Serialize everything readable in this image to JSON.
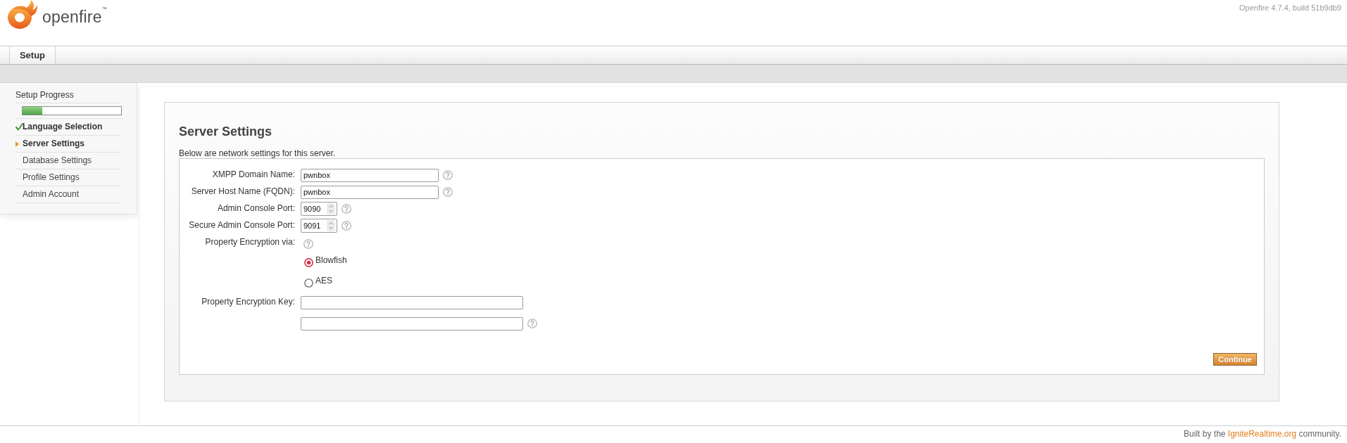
{
  "header": {
    "logo": "openfire$^{™}$",
    "version": "Openfire 4.7.4, build 51b9db9"
  },
  "tabs": [
    {
      "label": "Setup",
      "selected": true
    }
  ],
  "sidebar": {
    "title": "Setup Progress",
    "progress": {
      "level": 0.2
    },
    "steps": [
      {
        "label": "Language Selection",
        "completed": true,
        "selected": false
      },
      {
        "label": "Server Settings",
        "completed": false,
        "selected": true
      },
      {
        "label": "Database Settings",
        "completed": false,
        "selected": false
      },
      {
        "label": "Profile Settings",
        "completed": false,
        "selected": false
      },
      {
        "label": "Admin Account",
        "completed": false,
        "selected": false
      }
    ]
  },
  "form": {
    "title": "Server Settings",
    "intro": "Below are network settings for this server.",
    "fields": [
      {
        "kind": "text",
        "label": "XMPP Domain Name:",
        "value": "pwnbox",
        "help": true
      },
      {
        "kind": "text",
        "label": "Server Host Name (FQDN):",
        "value": "pwnbox",
        "help": true
      },
      {
        "kind": "number",
        "label": "Admin Console Port:",
        "value": "9090",
        "help": true
      },
      {
        "kind": "number",
        "label": "Secure Admin Console Port:",
        "value": "9091",
        "help": true
      },
      {
        "kind": "radio",
        "label": "Property Encryption via:",
        "help": true,
        "options": [
          {
            "label": "Blowfish",
            "selected": true
          },
          {
            "label": "AES",
            "selected": false
          }
        ]
      },
      {
        "kind": "wide",
        "label": "Property Encryption Key:",
        "help": false
      },
      {
        "kind": "wide",
        "help": true
      }
    ],
    "buttons": [
      {
        "label": "Continue"
      }
    ]
  },
  "footer": {
    "before": "Built by the ",
    "link": "IgniteRealtime.org",
    "after": " community."
  }
}
